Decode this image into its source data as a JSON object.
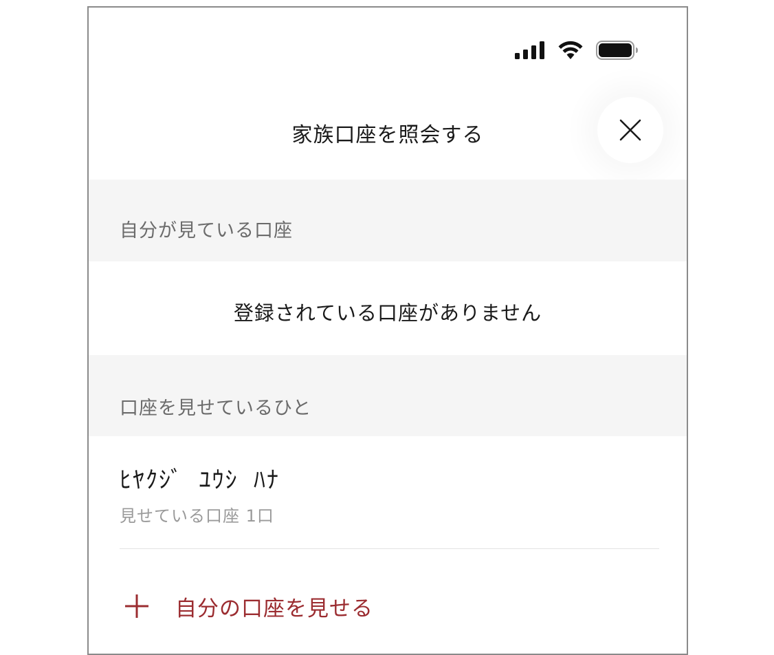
{
  "status_bar": {
    "icons": [
      "signal-icon",
      "wifi-icon",
      "battery-icon"
    ]
  },
  "header": {
    "title": "家族口座を照会する",
    "close_icon": "close-icon"
  },
  "sections": {
    "viewing": {
      "title": "自分が見ている口座",
      "empty_message": "登録されている口座がありません"
    },
    "sharing": {
      "title": "口座を見せているひと",
      "people": [
        {
          "name": "ﾋﾔｸｼﾞ ﾕｳｼ ﾊﾅ",
          "detail": "見せている口座 1口"
        }
      ]
    }
  },
  "add_action": {
    "icon": "plus-icon",
    "label": "自分の口座を見せる"
  },
  "colors": {
    "accent": "#9b2c30",
    "section_bg": "#f5f5f5",
    "text_primary": "#1a1a1a",
    "text_secondary": "#9a9a9a"
  }
}
